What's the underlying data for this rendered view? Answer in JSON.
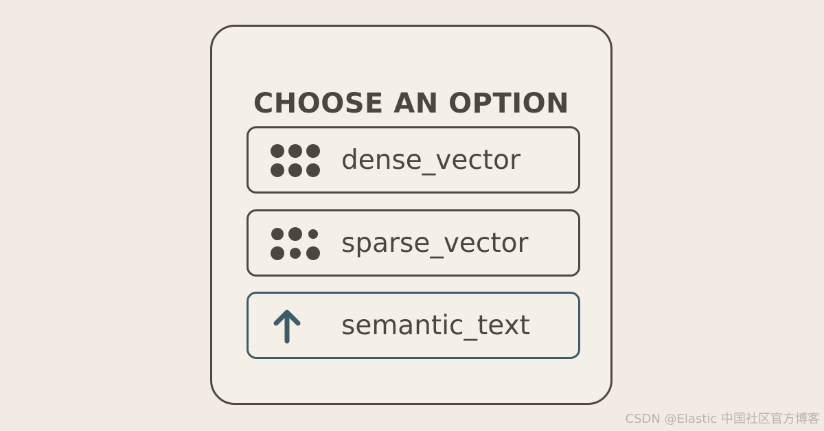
{
  "dialog": {
    "title": "CHOOSE AN OPTION",
    "options": [
      {
        "label": "dense_vector",
        "icon": "six-dots-grid-icon"
      },
      {
        "label": "sparse_vector",
        "icon": "sparse-dots-grid-icon"
      },
      {
        "label": "semantic_text",
        "icon": "arrow-up-icon",
        "accent_color": "#3f5d67"
      }
    ]
  },
  "watermark": "CSDN @Elastic 中国社区官方博客",
  "colors": {
    "background": "#f1ebe2",
    "ink": "#4a4743",
    "border": "#4d4a45",
    "accent": "#3f5d67"
  }
}
